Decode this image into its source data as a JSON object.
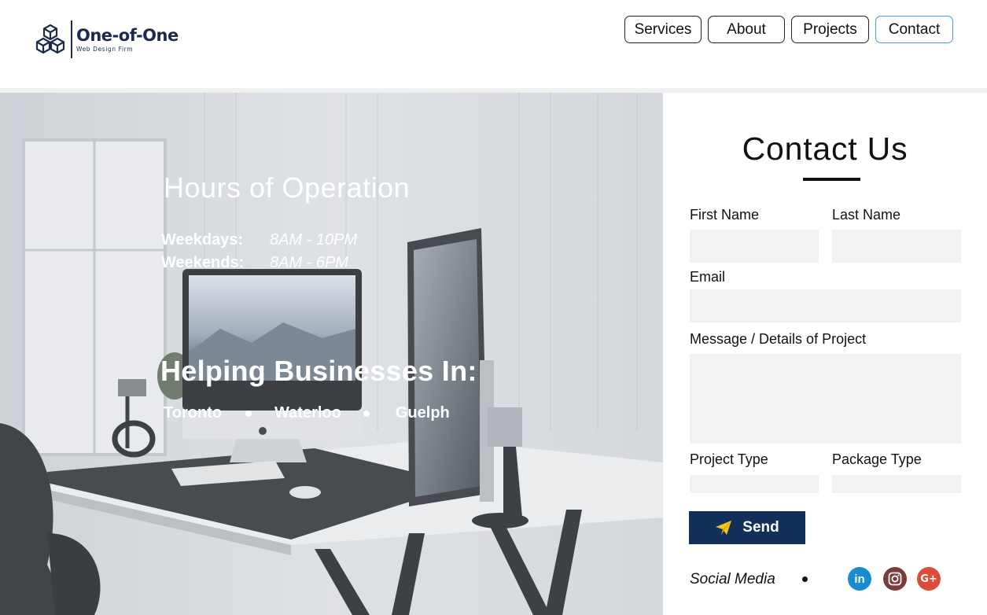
{
  "brand": {
    "name": "One-of-One",
    "tagline": "Web Design Firm"
  },
  "nav": {
    "items": [
      "Services",
      "About",
      "Projects",
      "Contact"
    ],
    "active": "Contact"
  },
  "hero": {
    "hours_title": "Hours of Operation",
    "hours": [
      {
        "day": "Weekdays:",
        "time": "8AM - 10PM"
      },
      {
        "day": "Weekends:",
        "time": "8AM - 6PM"
      }
    ],
    "helping_title": "Helping Businesses In:",
    "cities": [
      "Toronto",
      "Waterloo",
      "Guelph"
    ]
  },
  "contact": {
    "title": "Contact Us",
    "labels": {
      "first_name": "First Name",
      "last_name": "Last Name",
      "email": "Email",
      "message": "Message / Details of Project",
      "project_type": "Project Type",
      "package_type": "Package Type"
    },
    "values": {
      "first_name": "",
      "last_name": "",
      "email": "",
      "message": "",
      "project_type": "",
      "package_type": ""
    },
    "send_label": "Send",
    "social_label": "Social Media",
    "social": [
      {
        "name": "linkedin",
        "glyph": "in",
        "color": "#1a8ad1"
      },
      {
        "name": "instagram",
        "glyph": "",
        "color": "#7a3b3b"
      },
      {
        "name": "google-plus",
        "glyph": "G+",
        "color": "#dd4b39"
      }
    ]
  },
  "colors": {
    "brand_navy": "#1c2b4a",
    "send_button": "#12305a",
    "active_nav_border": "#3d9be9",
    "field_bg": "#f2f2f2"
  }
}
